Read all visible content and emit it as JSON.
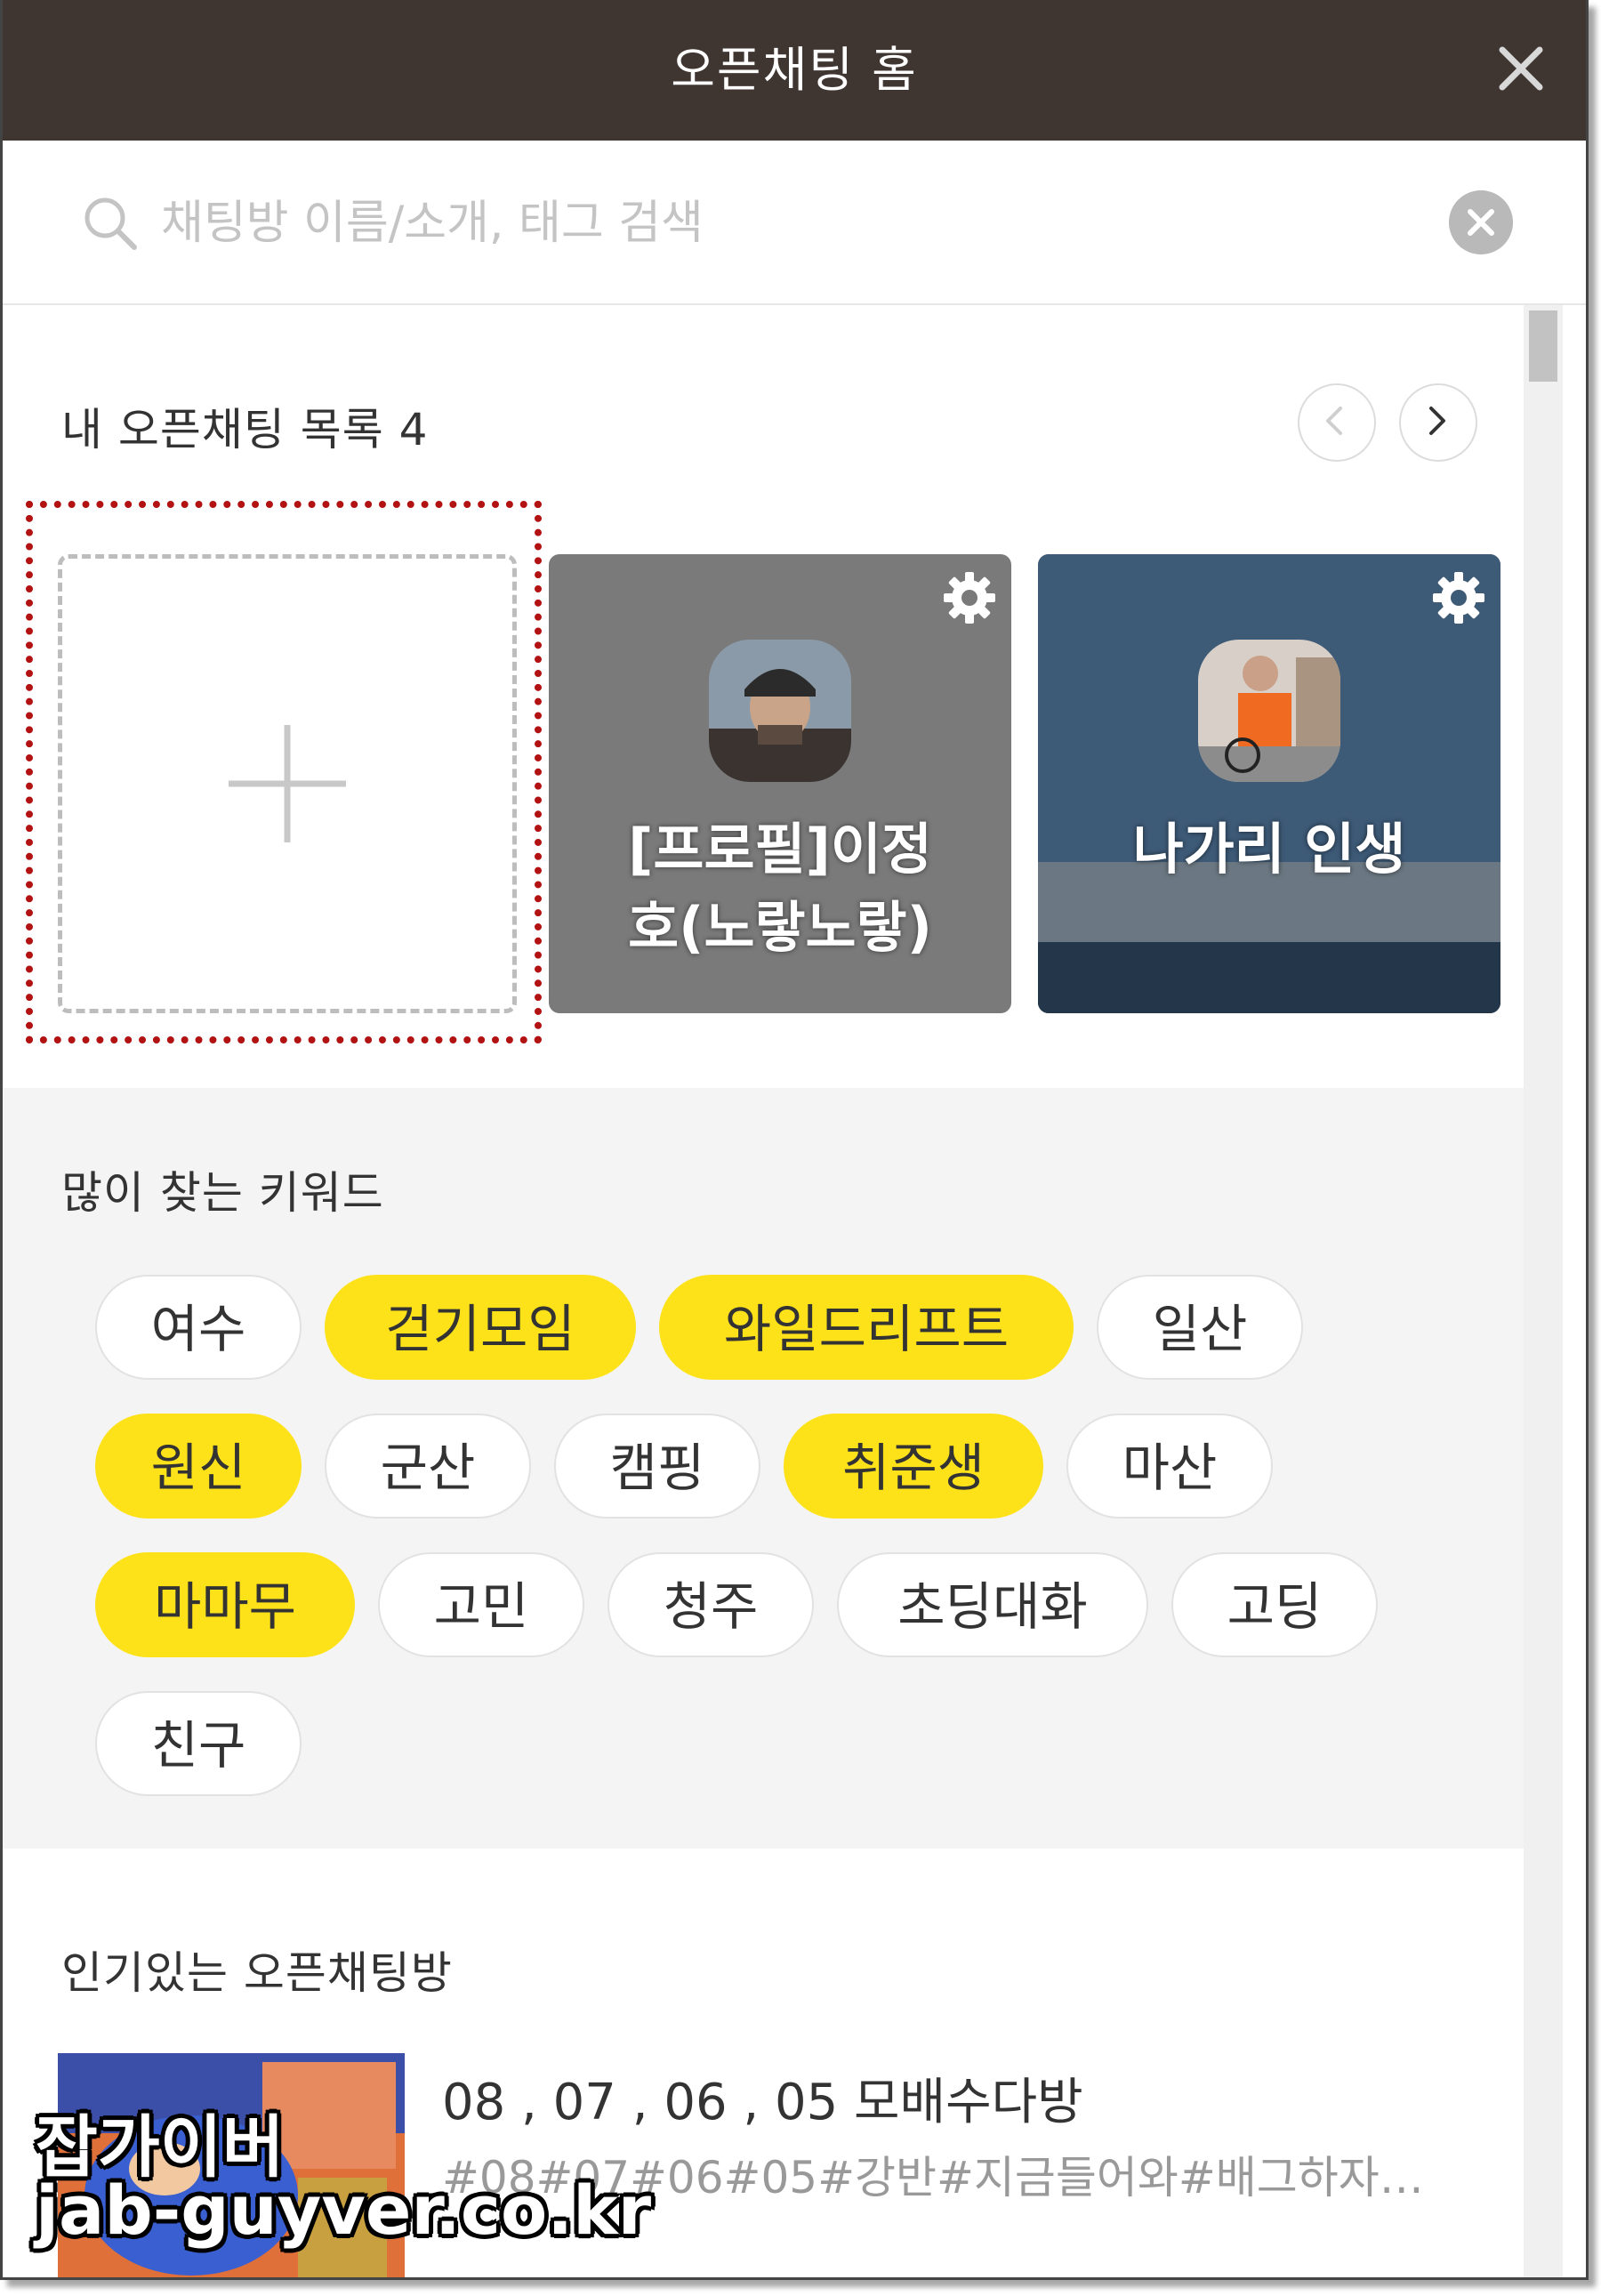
{
  "window": {
    "title": "오픈채팅 홈"
  },
  "search": {
    "placeholder": "채팅방 이름/소개, 태그 검색"
  },
  "my_chats": {
    "title": "내 오픈채팅 목록 4",
    "cards": [
      {
        "name": "[프로필]이정\n호(노랗노랗)",
        "line1": "[프로필]이정",
        "line2": "호(노랗노랗)"
      },
      {
        "name": "나가리 인생"
      }
    ]
  },
  "keywords": {
    "title": "많이 찾는 키워드",
    "tags": [
      {
        "label": "여수",
        "highlight": false
      },
      {
        "label": "걷기모임",
        "highlight": true
      },
      {
        "label": "와일드리프트",
        "highlight": true
      },
      {
        "label": "일산",
        "highlight": false
      },
      {
        "label": "원신",
        "highlight": true
      },
      {
        "label": "군산",
        "highlight": false
      },
      {
        "label": "캠핑",
        "highlight": false
      },
      {
        "label": "취준생",
        "highlight": true
      },
      {
        "label": "마산",
        "highlight": false
      },
      {
        "label": "마마무",
        "highlight": true
      },
      {
        "label": "고민",
        "highlight": false
      },
      {
        "label": "청주",
        "highlight": false
      },
      {
        "label": "초딩대화",
        "highlight": false
      },
      {
        "label": "고딩",
        "highlight": false
      },
      {
        "label": "친구",
        "highlight": false
      }
    ]
  },
  "popular": {
    "title": "인기있는 오픈채팅방",
    "rooms": [
      {
        "name": "08 , 07 , 06 , 05 모배수다방",
        "tags": "#08#07#06#05#강반#지금들어와#배그하자#여..."
      }
    ]
  },
  "watermark": {
    "line1": "잡가이버",
    "line2": "jab-guyver.co.kr"
  },
  "colors": {
    "titlebar": "#3f3531",
    "highlight": "#fde21a",
    "dotted_border": "#b31212",
    "card_gray": "#7a7a7a",
    "card_blue": "#3d5a77"
  }
}
